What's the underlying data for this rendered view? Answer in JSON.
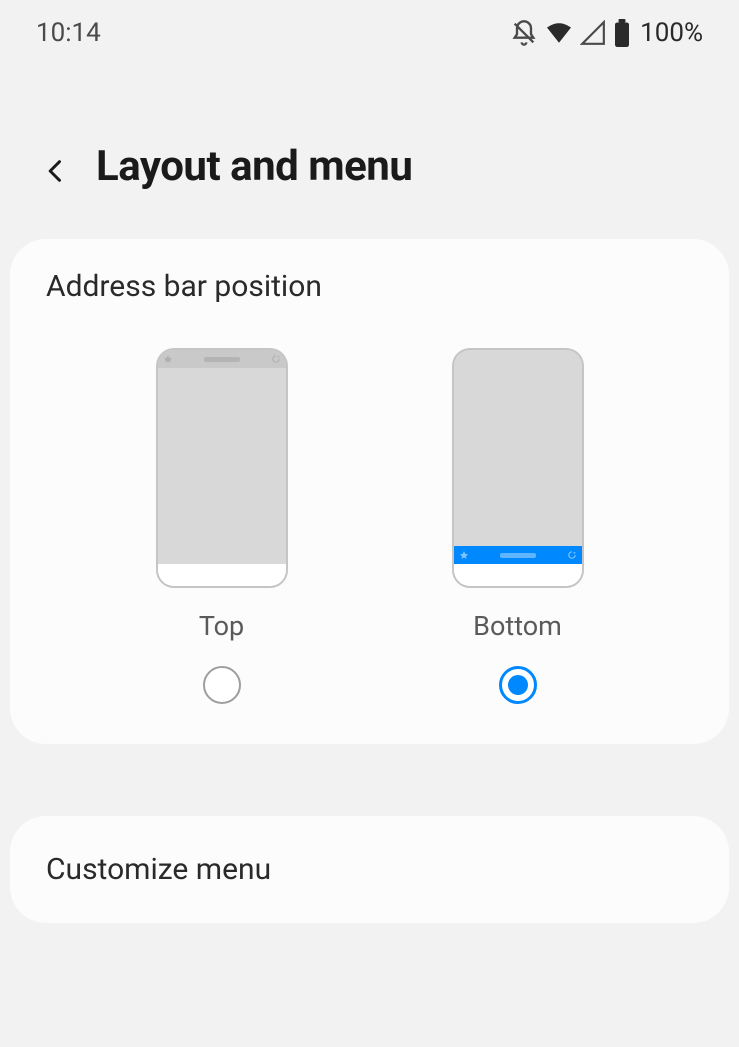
{
  "status_bar": {
    "time": "10:14",
    "battery_pct": "100%"
  },
  "header": {
    "title": "Layout and menu"
  },
  "address_bar_section": {
    "title": "Address bar position",
    "options": [
      {
        "label": "Top",
        "selected": false
      },
      {
        "label": "Bottom",
        "selected": true
      }
    ]
  },
  "customize_menu": {
    "label": "Customize menu"
  }
}
